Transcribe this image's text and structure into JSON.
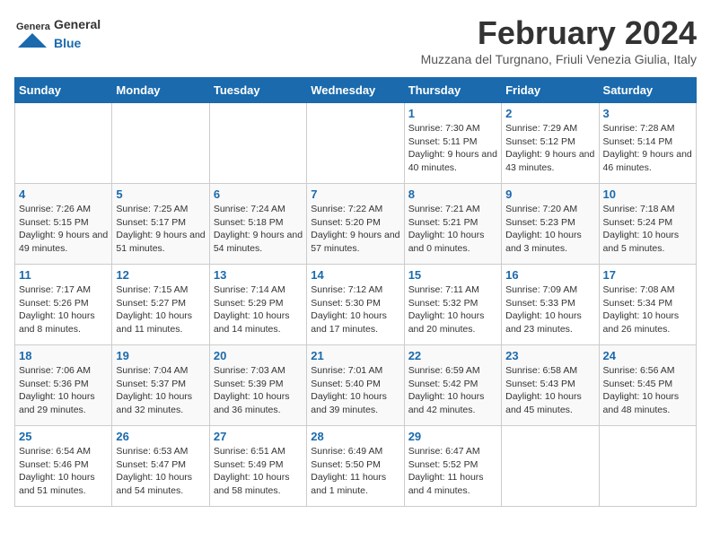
{
  "header": {
    "logo_general": "General",
    "logo_blue": "Blue",
    "month_title": "February 2024",
    "subtitle": "Muzzana del Turgnano, Friuli Venezia Giulia, Italy"
  },
  "days_of_week": [
    "Sunday",
    "Monday",
    "Tuesday",
    "Wednesday",
    "Thursday",
    "Friday",
    "Saturday"
  ],
  "weeks": [
    [
      {
        "day": "",
        "info": ""
      },
      {
        "day": "",
        "info": ""
      },
      {
        "day": "",
        "info": ""
      },
      {
        "day": "",
        "info": ""
      },
      {
        "day": "1",
        "info": "Sunrise: 7:30 AM\nSunset: 5:11 PM\nDaylight: 9 hours and 40 minutes."
      },
      {
        "day": "2",
        "info": "Sunrise: 7:29 AM\nSunset: 5:12 PM\nDaylight: 9 hours and 43 minutes."
      },
      {
        "day": "3",
        "info": "Sunrise: 7:28 AM\nSunset: 5:14 PM\nDaylight: 9 hours and 46 minutes."
      }
    ],
    [
      {
        "day": "4",
        "info": "Sunrise: 7:26 AM\nSunset: 5:15 PM\nDaylight: 9 hours and 49 minutes."
      },
      {
        "day": "5",
        "info": "Sunrise: 7:25 AM\nSunset: 5:17 PM\nDaylight: 9 hours and 51 minutes."
      },
      {
        "day": "6",
        "info": "Sunrise: 7:24 AM\nSunset: 5:18 PM\nDaylight: 9 hours and 54 minutes."
      },
      {
        "day": "7",
        "info": "Sunrise: 7:22 AM\nSunset: 5:20 PM\nDaylight: 9 hours and 57 minutes."
      },
      {
        "day": "8",
        "info": "Sunrise: 7:21 AM\nSunset: 5:21 PM\nDaylight: 10 hours and 0 minutes."
      },
      {
        "day": "9",
        "info": "Sunrise: 7:20 AM\nSunset: 5:23 PM\nDaylight: 10 hours and 3 minutes."
      },
      {
        "day": "10",
        "info": "Sunrise: 7:18 AM\nSunset: 5:24 PM\nDaylight: 10 hours and 5 minutes."
      }
    ],
    [
      {
        "day": "11",
        "info": "Sunrise: 7:17 AM\nSunset: 5:26 PM\nDaylight: 10 hours and 8 minutes."
      },
      {
        "day": "12",
        "info": "Sunrise: 7:15 AM\nSunset: 5:27 PM\nDaylight: 10 hours and 11 minutes."
      },
      {
        "day": "13",
        "info": "Sunrise: 7:14 AM\nSunset: 5:29 PM\nDaylight: 10 hours and 14 minutes."
      },
      {
        "day": "14",
        "info": "Sunrise: 7:12 AM\nSunset: 5:30 PM\nDaylight: 10 hours and 17 minutes."
      },
      {
        "day": "15",
        "info": "Sunrise: 7:11 AM\nSunset: 5:32 PM\nDaylight: 10 hours and 20 minutes."
      },
      {
        "day": "16",
        "info": "Sunrise: 7:09 AM\nSunset: 5:33 PM\nDaylight: 10 hours and 23 minutes."
      },
      {
        "day": "17",
        "info": "Sunrise: 7:08 AM\nSunset: 5:34 PM\nDaylight: 10 hours and 26 minutes."
      }
    ],
    [
      {
        "day": "18",
        "info": "Sunrise: 7:06 AM\nSunset: 5:36 PM\nDaylight: 10 hours and 29 minutes."
      },
      {
        "day": "19",
        "info": "Sunrise: 7:04 AM\nSunset: 5:37 PM\nDaylight: 10 hours and 32 minutes."
      },
      {
        "day": "20",
        "info": "Sunrise: 7:03 AM\nSunset: 5:39 PM\nDaylight: 10 hours and 36 minutes."
      },
      {
        "day": "21",
        "info": "Sunrise: 7:01 AM\nSunset: 5:40 PM\nDaylight: 10 hours and 39 minutes."
      },
      {
        "day": "22",
        "info": "Sunrise: 6:59 AM\nSunset: 5:42 PM\nDaylight: 10 hours and 42 minutes."
      },
      {
        "day": "23",
        "info": "Sunrise: 6:58 AM\nSunset: 5:43 PM\nDaylight: 10 hours and 45 minutes."
      },
      {
        "day": "24",
        "info": "Sunrise: 6:56 AM\nSunset: 5:45 PM\nDaylight: 10 hours and 48 minutes."
      }
    ],
    [
      {
        "day": "25",
        "info": "Sunrise: 6:54 AM\nSunset: 5:46 PM\nDaylight: 10 hours and 51 minutes."
      },
      {
        "day": "26",
        "info": "Sunrise: 6:53 AM\nSunset: 5:47 PM\nDaylight: 10 hours and 54 minutes."
      },
      {
        "day": "27",
        "info": "Sunrise: 6:51 AM\nSunset: 5:49 PM\nDaylight: 10 hours and 58 minutes."
      },
      {
        "day": "28",
        "info": "Sunrise: 6:49 AM\nSunset: 5:50 PM\nDaylight: 11 hours and 1 minute."
      },
      {
        "day": "29",
        "info": "Sunrise: 6:47 AM\nSunset: 5:52 PM\nDaylight: 11 hours and 4 minutes."
      },
      {
        "day": "",
        "info": ""
      },
      {
        "day": "",
        "info": ""
      }
    ]
  ]
}
